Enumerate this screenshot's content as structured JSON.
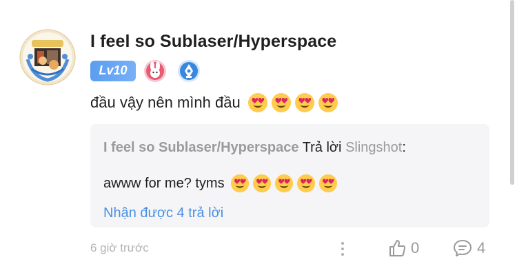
{
  "comment": {
    "username": "I feel so Sublaser/Hyperspace",
    "level_badge": "Lv10",
    "badges": [
      "bunny-medal-icon",
      "pen-medal-icon"
    ],
    "text": "đầu vậy nên mình đầu",
    "text_emoji_count": 4,
    "timestamp": "6 giờ trước",
    "likes": "0",
    "replies": "4"
  },
  "reply": {
    "author": "I feel so Sublaser/Hyperspace",
    "action": "Trả lời",
    "target": "Slingshot",
    "separator": ":",
    "text": "awww for me? tyms",
    "text_emoji_count": 5,
    "more_replies": "Nhận được 4 trả lời"
  },
  "colors": {
    "level_badge": "#5b9df0",
    "link": "#4a90e2",
    "muted": "#9a9a9a",
    "reply_bg": "#f5f5f7"
  }
}
